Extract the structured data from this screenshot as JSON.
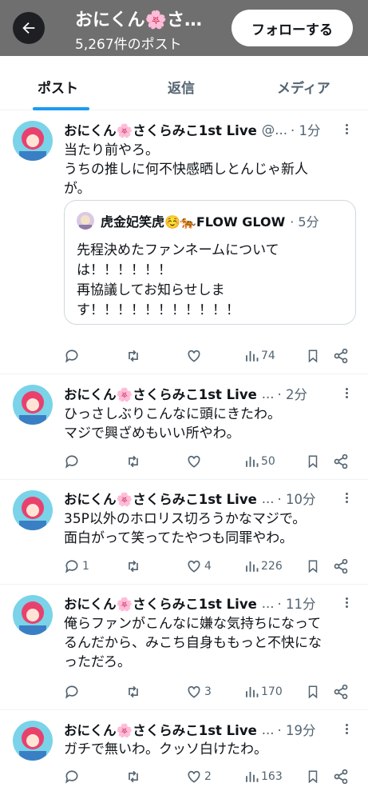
{
  "header": {
    "title": "おにくん🌸さ…",
    "post_count": "5,267件のポスト",
    "follow_label": "フォローする"
  },
  "tabs": [
    {
      "label": "ポスト",
      "active": true
    },
    {
      "label": "返信",
      "active": false
    },
    {
      "label": "メディア",
      "active": false
    }
  ],
  "author": "おにくん🌸さくらみこ1st Live",
  "posts": [
    {
      "handle": "@...",
      "time": "· 1分",
      "lines": [
        "当たり前やろ。",
        "うちの推しに何不快感晒しとんじゃ新人",
        "が。"
      ],
      "quote": {
        "author": "虎金妃笑虎☺️🐅FLOW GLOW",
        "time": "· 5分",
        "lines": [
          "先程決めたファンネームについて",
          "は！！！！！！",
          "再協議してお知らせしま",
          "す！！！！！！！！！！！"
        ]
      },
      "replies": "",
      "likes": "",
      "views": "74"
    },
    {
      "handle": "...",
      "time": "· 2分",
      "lines": [
        "ひっさしぶりこんなに頭にきたわ。",
        "マジで興ざめもいい所やわ。"
      ],
      "replies": "",
      "likes": "",
      "views": "50"
    },
    {
      "handle": "...",
      "time": "· 10分",
      "lines": [
        "35P以外のホロリス切ろうかなマジで。",
        "面白がって笑ってたやつも同罪やわ。"
      ],
      "replies": "1",
      "likes": "4",
      "views": "226"
    },
    {
      "handle": "...",
      "time": "· 11分",
      "lines": [
        "俺らファンがこんなに嫌な気持ちになって",
        "るんだから、みこち自身ももっと不快にな",
        "っただろ。"
      ],
      "replies": "",
      "likes": "3",
      "views": "170"
    },
    {
      "handle": "...",
      "time": "· 19分",
      "lines": [
        "ガチで無いわ。クッソ白けたわ。"
      ],
      "replies": "",
      "likes": "2",
      "views": "163"
    }
  ],
  "colors": {
    "header_bg": "#6f6f6f",
    "accent": "#1d9bf0",
    "secondary_text": "#536471",
    "avatar_bg": "#7ad3e8",
    "avatar_hair": "#e8416e"
  }
}
